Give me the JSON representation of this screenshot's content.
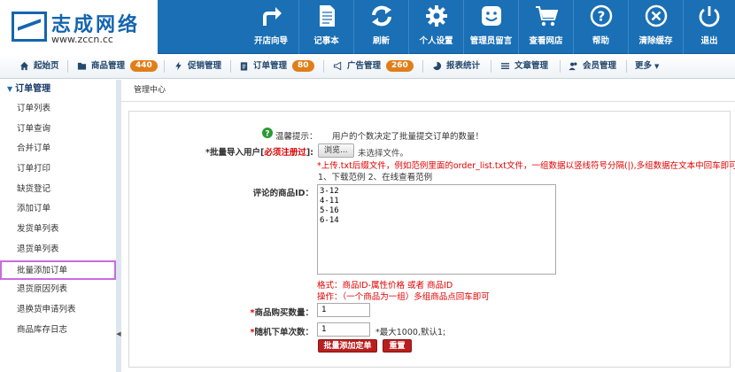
{
  "logo": {
    "name": "志成网络",
    "url": "www.zccn.cc"
  },
  "toolbar": [
    {
      "label": "开店向导",
      "icon": "share-arrow-icon"
    },
    {
      "label": "记事本",
      "icon": "notepad-icon"
    },
    {
      "label": "刷新",
      "icon": "refresh-icon"
    },
    {
      "label": "个人设置",
      "icon": "gear-icon"
    },
    {
      "label": "管理员留言",
      "icon": "smiley-message-icon"
    },
    {
      "label": "查看网店",
      "icon": "cart-icon"
    },
    {
      "label": "帮助",
      "icon": "question-icon"
    },
    {
      "label": "清除缓存",
      "icon": "close-circle-icon"
    },
    {
      "label": "退出",
      "icon": "power-icon"
    }
  ],
  "nav": {
    "home": "起始页",
    "goods": "商品管理",
    "goods_count": "440",
    "promo": "促销管理",
    "orders": "订单管理",
    "orders_count": "80",
    "ads": "广告管理",
    "ads_count": "260",
    "stats": "报表统计",
    "articles": "文章管理",
    "members": "会员管理",
    "more": "更多"
  },
  "sidebar": {
    "title": "订单管理",
    "items": [
      "订单列表",
      "订单查询",
      "合并订单",
      "订单打印",
      "缺货登记",
      "添加订单",
      "发货单列表",
      "退货单列表",
      "批量添加订单",
      "退货原因列表",
      "退换货申请列表",
      "商品库存日志"
    ],
    "active_index": 8
  },
  "breadcrumb": "管理中心",
  "form": {
    "tip_label": "温馨提示：",
    "tip_text": "用户的个数决定了批量提交订单的数量！",
    "import_label_prefix": "*批量导入用户[",
    "import_link": "必须注册过",
    "import_label_suffix": "]:",
    "browse_btn": "浏览...",
    "no_file": "未选择文件。",
    "upload_note": "*上传.txt后缀文件，例如范例里面的order_list.txt文件，一组数据以竖线符号分隔(|),多组数据在文本中回车即可",
    "examples": "1、下载范例  2、在线查看范例",
    "goods_id_label": "评论的商品ID：",
    "goods_ids": "3-12\n4-11\n5-16\n6-14",
    "format_note": "格式：商品ID-属性价格 或者 商品ID",
    "op_note": "操作：（一个商品为一组）多组商品点回车即可",
    "qty_label": "*商品购买数量：",
    "qty_value": "1",
    "times_label": "*随机下单次数：",
    "times_value": "1",
    "times_note": "*最大1000,默认1;",
    "submit_btn": "批量添加定单",
    "reset_btn": "重置"
  }
}
